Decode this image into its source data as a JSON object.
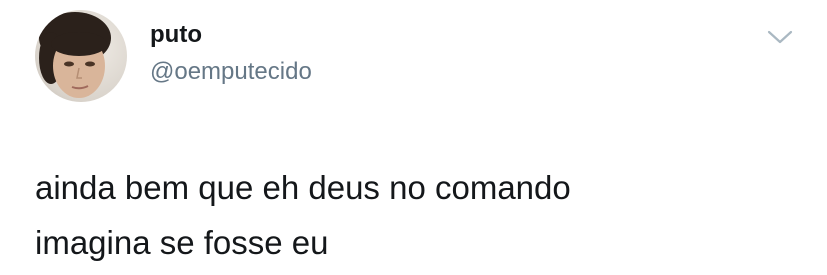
{
  "tweet": {
    "author": {
      "display_name": "puto",
      "handle": "@oemputecido",
      "avatar": "profile-photo"
    },
    "menu_icon": "chevron-down-icon",
    "text_lines": [
      "ainda bem que eh deus no comando",
      "imagina se fosse eu"
    ]
  },
  "colors": {
    "text_primary": "#14171a",
    "text_secondary": "#657786",
    "icon": "#aab8c2",
    "background": "#ffffff"
  }
}
